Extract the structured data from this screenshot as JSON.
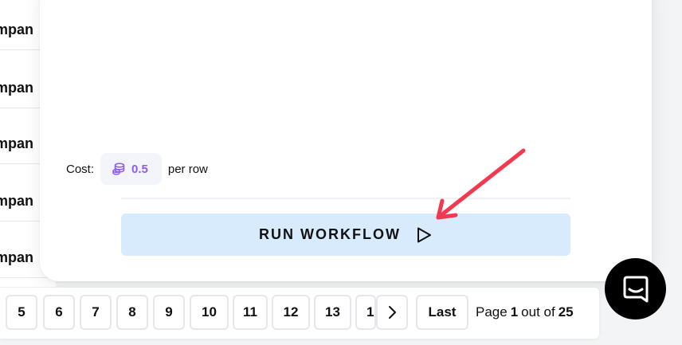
{
  "background_table": {
    "row_text": [
      "mpan",
      "mpan",
      "mpan",
      "mpan",
      "mpan"
    ]
  },
  "panel": {
    "cost": {
      "label": "Cost:",
      "value": "0.5",
      "unit": "per row",
      "icon": "coins-icon",
      "color": "#8b5cf6"
    },
    "run_button": {
      "label": "RUN WORKFLOW",
      "icon": "play-icon",
      "background": "#d8ebfc"
    }
  },
  "annotation": {
    "arrow_color": "#f2394f"
  },
  "pagination": {
    "pages": [
      "5",
      "6",
      "7",
      "8",
      "9",
      "10",
      "11",
      "12",
      "13",
      "1"
    ],
    "next_icon": "chevron-right-icon",
    "last_label": "Last",
    "info": {
      "prefix": "Page",
      "current": "1",
      "middle": "out of",
      "total": "25"
    }
  },
  "chat_launcher": {
    "icon": "chat-icon"
  }
}
